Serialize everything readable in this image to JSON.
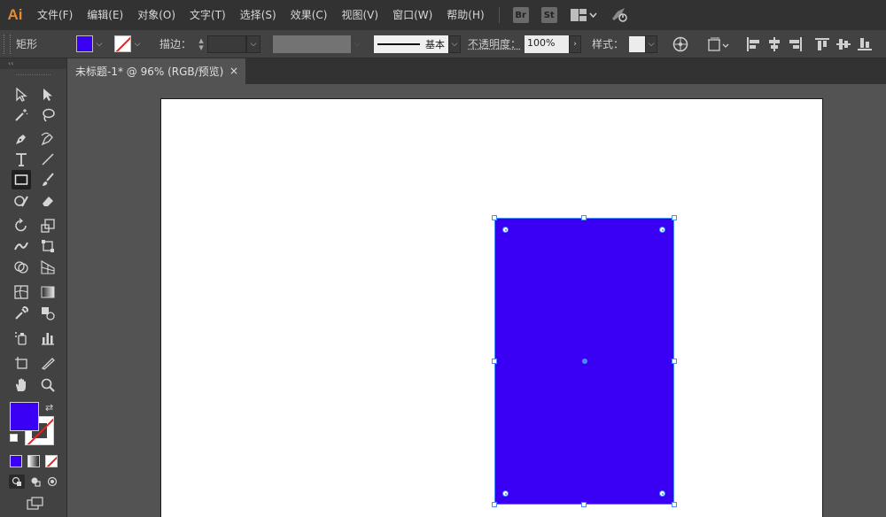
{
  "app": {
    "logo": "Ai"
  },
  "menu": [
    "文件(F)",
    "编辑(E)",
    "对象(O)",
    "文字(T)",
    "选择(S)",
    "效果(C)",
    "视图(V)",
    "窗口(W)",
    "帮助(H)"
  ],
  "bridge": {
    "br": "Br",
    "st": "St"
  },
  "control": {
    "object_type": "矩形",
    "stroke_label": "描边：",
    "brush_name": "基本",
    "opacity_label": "不透明度：",
    "opacity_value": "100%",
    "style_label": "样式："
  },
  "colors": {
    "fill": "#3a00f4",
    "stroke": "none",
    "accent": "#4a8bff"
  },
  "document": {
    "tab_title": "未标题-1* @ 96% (RGB/预览)",
    "close_glyph": "×"
  },
  "toolbox": {
    "collapse_glyph": "‹‹",
    "tools": [
      [
        "selection-tool",
        "direct-selection-tool"
      ],
      [
        "magic-wand-tool",
        "lasso-tool"
      ],
      [
        "pen-tool",
        "curvature-tool"
      ],
      [
        "type-tool",
        "line-segment-tool"
      ],
      [
        "rectangle-tool",
        "paintbrush-tool"
      ],
      [
        "shaper-tool",
        "eraser-tool"
      ],
      [
        "rotate-tool",
        "scale-tool"
      ],
      [
        "width-tool",
        "free-transform-tool"
      ],
      [
        "shape-builder-tool",
        "perspective-grid-tool"
      ],
      [
        "mesh-tool",
        "gradient-tool"
      ],
      [
        "eyedropper-tool",
        "blend-tool"
      ],
      [
        "symbol-sprayer-tool",
        "column-graph-tool"
      ],
      [
        "artboard-tool",
        "slice-tool"
      ],
      [
        "hand-tool",
        "zoom-tool"
      ]
    ]
  }
}
